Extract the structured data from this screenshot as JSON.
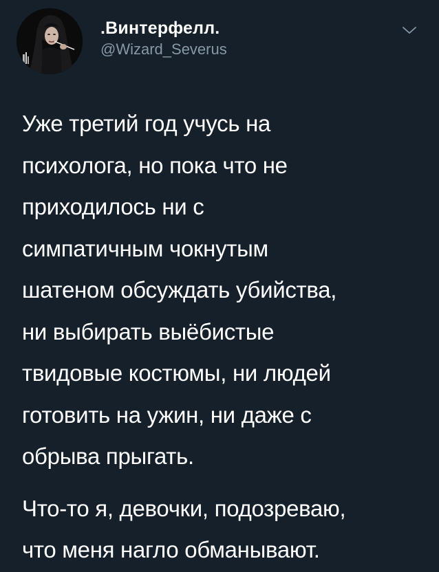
{
  "author": {
    "display_name": ".Винтерфелл.",
    "handle": "@Wizard_Severus",
    "avatar_icon": "profile-photo"
  },
  "menu": {
    "icon": "chevron-down-icon"
  },
  "tweet": {
    "paragraphs": [
      {
        "lines": [
          "Уже третий год учусь на",
          "психолога, но пока что не",
          "приходилось ни с",
          "симпатичным чокнутым",
          "шатеном обсуждать убийства,",
          "ни выбирать выёбистые",
          "твидовые костюмы, ни людей",
          "готовить на ужин, ни даже с",
          "обрыва прыгать."
        ]
      },
      {
        "lines": [
          "Что-то я, девочки, подозреваю,",
          "что меня нагло обманывают."
        ]
      }
    ]
  },
  "colors": {
    "background": "#15202b",
    "text": "#ffffff",
    "secondary": "#8899a6"
  }
}
